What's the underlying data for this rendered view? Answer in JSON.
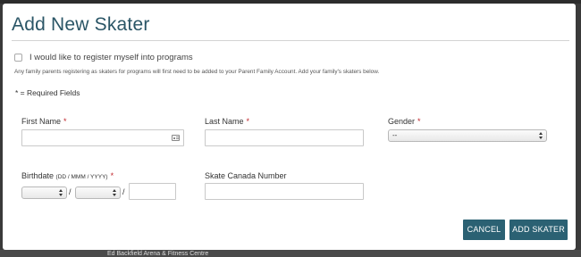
{
  "modal": {
    "title": "Add New Skater",
    "register_label": "I would like to register myself into programs",
    "info_text": "Any family parents registering as skaters for programs will first need to be added to your Parent Family Account. Add your family's skaters below.",
    "required_note": "* = Required Fields"
  },
  "fields": {
    "first_name_label": "First Name",
    "last_name_label": "Last Name",
    "gender_label": "Gender",
    "gender_value": "--",
    "birthdate_label": "Birthdate",
    "birthdate_format": "(DD / MMM / YYYY)",
    "birthdate_separator": "/",
    "skate_canada_label": "Skate Canada Number",
    "required_star": "*"
  },
  "buttons": {
    "cancel": "CANCEL",
    "add_skater": "ADD SKATER"
  },
  "background": {
    "partial_text": "Ed Backfield Arena & Fitness Centre"
  },
  "colors": {
    "title": "#2a5566",
    "button": "#2b6173",
    "required": "#c0272d"
  }
}
